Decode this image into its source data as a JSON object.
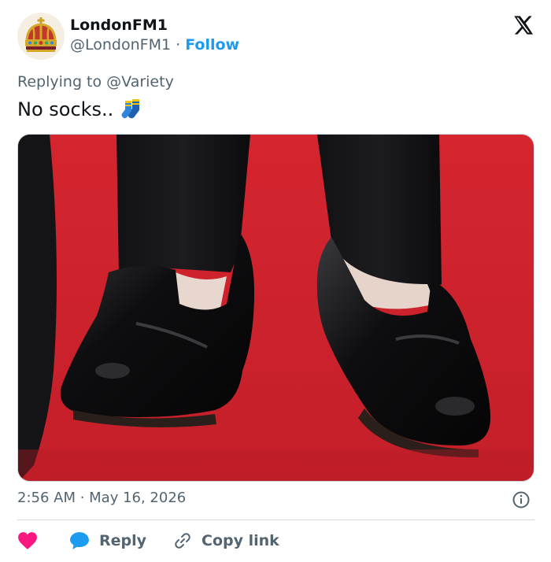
{
  "header": {
    "display_name": "LondonFM1",
    "handle": "@LondonFM1",
    "separator": "·",
    "follow_label": "Follow",
    "avatar_icon": "royal-crown-logo",
    "platform_icon": "x-logo-icon"
  },
  "tweet": {
    "replying_to_label": "Replying to",
    "replying_to_handle": "@Variety",
    "text": "No socks..",
    "emoji_icon": "socks-emoji-icon",
    "image_alt": "Black leather loafers worn without socks on a red carpet"
  },
  "meta": {
    "timestamp": "2:56 AM · May 16, 2026",
    "info_icon": "info-icon"
  },
  "actions": {
    "like_icon": "heart-icon",
    "reply_label": "Reply",
    "copy_link_label": "Copy link"
  },
  "colors": {
    "accent": "#1d9bf0",
    "like": "#f91880",
    "text": "#0f1419",
    "muted": "#536471",
    "border": "#cfd9de"
  }
}
